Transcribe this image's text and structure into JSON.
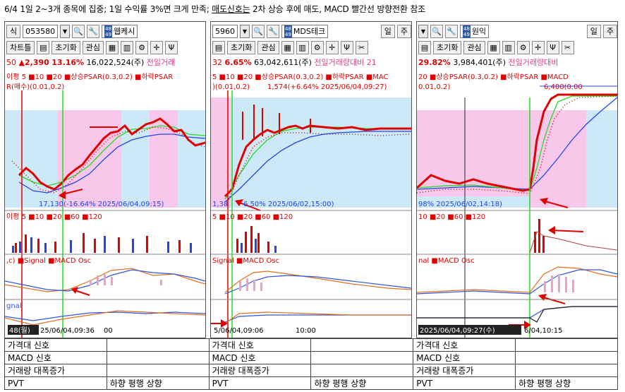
{
  "header": {
    "part1": "6/4 1일 2~3개 종목에 집중; 1일 수익률 3%면 크게 만족; ",
    "part2": "매도신호는",
    "part3": " 2차 상승 후에 매도, MACD 빨간선 방향전환 참조"
  },
  "panels": [
    {
      "id": "p1",
      "tab": "식",
      "code": "053580",
      "name": "웹케시",
      "day_btn": "",
      "week_btn": "",
      "tb_chart": "차트틀",
      "tb_reset": "초기화",
      "tb_interest": "관심",
      "quote_prefix": "50",
      "change": "▲2,390",
      "pct": "13.16%",
      "volume": "16,022,524(주)",
      "prev_vol": "전일거래",
      "ind_line1": "이평 5 ■10 ■20 ■상승PSAR(0.3,0.2) ■하락PSAR",
      "ind_line2": "R(매수)(0.01,0.2)",
      "price_annot": "17,130(-16.64% 2025/06/04,09:15)",
      "vol_legend": "이평 5 ■10 ■20 ■60 ■120",
      "macd_legend": ",c) ■Signal ■MACD Osc",
      "pvt_legend": "gnal",
      "time_box": "48(월)",
      "time_label": "25/06/04,09:36",
      "time_tail": "00"
    },
    {
      "id": "p2",
      "tab": "",
      "code": "5960",
      "name": "MDS테크",
      "day_btn": "일",
      "week_btn": "주",
      "tb_chart": "",
      "tb_reset": "초기화",
      "tb_interest": "관심",
      "quote_prefix": "32",
      "change": "",
      "pct": "6.65%",
      "volume": "63,042,611(주)",
      "prev_vol": "전일거래량대비 21",
      "ind_line1": "5 ■10 ■20 ■상승PSAR(0.3,0.2) ■하락PSAR ■MAC",
      "ind_line2": ")(0.01,0.2)",
      "ind_annot": "1,574(+6.64% 2025/06/04,09:27)",
      "price_annot": "1,38",
      "price_annot2": "6.50% 2025/06/02,15:00)",
      "vol_legend": "5 ■10 ■20 ■60 ■120",
      "macd_legend": "Signal ■MACD Osc",
      "pvt_legend": "",
      "time_box": "",
      "time_label": "5/06/04,09:06",
      "time_tail": "10:00"
    },
    {
      "id": "p3",
      "tab": "",
      "code": "",
      "name": "원익",
      "day_btn": "일",
      "week_btn": "주",
      "tb_chart": "",
      "tb_reset": "초기화",
      "tb_interest": "관심",
      "quote_prefix": "",
      "change": "",
      "pct": "29.82%",
      "volume": "3,984,401(주)",
      "prev_vol": "전일거래량대비",
      "ind_line1": "20 ■상승PSAR(0.3,0.2) ■하락PSAR ■MACD",
      "ind_line2": "0.01,0.2)",
      "ind_annot": "6,400(0.00",
      "price_annot": "98% 2025/06/02,14:18)",
      "vol_legend": "10 ■20 ■60 ■120",
      "macd_legend": "nal ■MACD Osc",
      "pvt_legend": "",
      "time_box": "2025/06/04,09:27(수)",
      "time_label": "6/04,10:15",
      "time_tail": ""
    }
  ],
  "table": {
    "rows": [
      {
        "label": "가격대 신호",
        "cells": [
          "",
          "가격대 신호",
          "",
          "가격대 신호",
          ""
        ]
      },
      {
        "label": "MACD 신호",
        "cells": [
          "",
          "MACD 신호",
          "",
          "MACD 신호",
          ""
        ]
      },
      {
        "label": "거래량 대폭증가",
        "cells": [
          "",
          "거래량 대폭증가",
          "",
          "거래량 대폭증가",
          ""
        ]
      },
      {
        "label": "PVT",
        "cells": [
          "하향 평행 상향",
          "PVT",
          "하향 평행 상향",
          "PVT",
          "하향 평행 상향"
        ]
      }
    ]
  },
  "colors": {
    "accent_red": "#e00000",
    "pink_band": "#f7c8ea",
    "blue_band": "#cde9f8",
    "green_line": "#22dd22",
    "blue_line": "#2244ee"
  }
}
